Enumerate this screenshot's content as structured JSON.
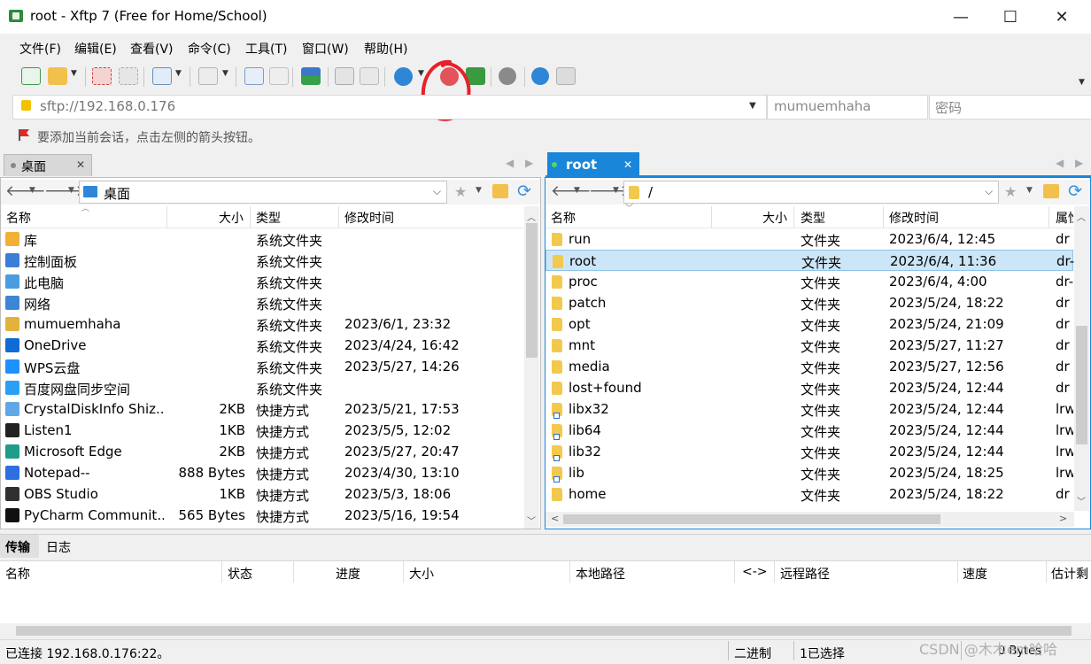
{
  "window": {
    "title": "root - Xftp 7 (Free for Home/School)",
    "controls": {
      "minimize": "—",
      "maximize": "☐",
      "close": "✕"
    }
  },
  "menu": [
    "文件(F)",
    "编辑(E)",
    "查看(V)",
    "命令(C)",
    "工具(T)",
    "窗口(W)",
    "帮助(H)"
  ],
  "address": {
    "url": "sftp://192.168.0.176",
    "username": "mumuemhaha",
    "password_placeholder": "密码"
  },
  "hint": "要添加当前会话，点击左侧的箭头按钮。",
  "left_panel": {
    "tab": "桌面",
    "path": "桌面",
    "columns": [
      "名称",
      "大小",
      "类型",
      "修改时间"
    ],
    "rows": [
      {
        "name": "库",
        "size": "",
        "type": "系统文件夹",
        "modified": "",
        "icon": "library-icon",
        "color": "#f2b134"
      },
      {
        "name": "控制面板",
        "size": "",
        "type": "系统文件夹",
        "modified": "",
        "icon": "control-panel-icon",
        "color": "#3a7fd5"
      },
      {
        "name": "此电脑",
        "size": "",
        "type": "系统文件夹",
        "modified": "",
        "icon": "computer-icon",
        "color": "#4a9de0"
      },
      {
        "name": "网络",
        "size": "",
        "type": "系统文件夹",
        "modified": "",
        "icon": "network-icon",
        "color": "#3d86d6"
      },
      {
        "name": "mumuemhaha",
        "size": "",
        "type": "系统文件夹",
        "modified": "2023/6/1, 23:32",
        "icon": "user-folder-icon",
        "color": "#e3b23c"
      },
      {
        "name": "OneDrive",
        "size": "",
        "type": "系统文件夹",
        "modified": "2023/4/24, 16:42",
        "icon": "onedrive-icon",
        "color": "#0f6cd5"
      },
      {
        "name": "WPS云盘",
        "size": "",
        "type": "系统文件夹",
        "modified": "2023/5/27, 14:26",
        "icon": "wps-cloud-icon",
        "color": "#1e90ff"
      },
      {
        "name": "百度网盘同步空间",
        "size": "",
        "type": "系统文件夹",
        "modified": "",
        "icon": "baidu-netdisk-icon",
        "color": "#2aa0f5"
      },
      {
        "name": "CrystalDiskInfo Shiz...",
        "size": "2KB",
        "type": "快捷方式",
        "modified": "2023/5/21, 17:53",
        "icon": "crystaldiskinfo-icon",
        "color": "#5fa8e8"
      },
      {
        "name": "Listen1",
        "size": "1KB",
        "type": "快捷方式",
        "modified": "2023/5/5, 12:02",
        "icon": "listen1-icon",
        "color": "#222222"
      },
      {
        "name": "Microsoft Edge",
        "size": "2KB",
        "type": "快捷方式",
        "modified": "2023/5/27, 20:47",
        "icon": "edge-icon",
        "color": "#1f9c8a"
      },
      {
        "name": "Notepad--",
        "size": "888 Bytes",
        "type": "快捷方式",
        "modified": "2023/4/30, 13:10",
        "icon": "notepad-icon",
        "color": "#2d6ee0"
      },
      {
        "name": "OBS Studio",
        "size": "1KB",
        "type": "快捷方式",
        "modified": "2023/5/3, 18:06",
        "icon": "obs-icon",
        "color": "#303030"
      },
      {
        "name": "PyCharm Communit...",
        "size": "565 Bytes",
        "type": "快捷方式",
        "modified": "2023/5/16, 19:54",
        "icon": "pycharm-icon",
        "color": "#111111"
      }
    ]
  },
  "right_panel": {
    "tab": "root",
    "path": "/",
    "columns": [
      "名称",
      "大小",
      "类型",
      "修改时间",
      "属性"
    ],
    "rows": [
      {
        "name": "run",
        "type": "文件夹",
        "modified": "2023/6/4, 12:45",
        "attr": "dr",
        "link": false
      },
      {
        "name": "root",
        "type": "文件夹",
        "modified": "2023/6/4, 11:36",
        "attr": "dr-",
        "link": false,
        "selected": true
      },
      {
        "name": "proc",
        "type": "文件夹",
        "modified": "2023/6/4, 4:00",
        "attr": "dr-",
        "link": false
      },
      {
        "name": "patch",
        "type": "文件夹",
        "modified": "2023/5/24, 18:22",
        "attr": "dr",
        "link": false
      },
      {
        "name": "opt",
        "type": "文件夹",
        "modified": "2023/5/24, 21:09",
        "attr": "dr",
        "link": false
      },
      {
        "name": "mnt",
        "type": "文件夹",
        "modified": "2023/5/27, 11:27",
        "attr": "dr",
        "link": false
      },
      {
        "name": "media",
        "type": "文件夹",
        "modified": "2023/5/27, 12:56",
        "attr": "dr",
        "link": false
      },
      {
        "name": "lost+found",
        "type": "文件夹",
        "modified": "2023/5/24, 12:44",
        "attr": "dr",
        "link": false
      },
      {
        "name": "libx32",
        "type": "文件夹",
        "modified": "2023/5/24, 12:44",
        "attr": "lrw",
        "link": true
      },
      {
        "name": "lib64",
        "type": "文件夹",
        "modified": "2023/5/24, 12:44",
        "attr": "lrw",
        "link": true
      },
      {
        "name": "lib32",
        "type": "文件夹",
        "modified": "2023/5/24, 12:44",
        "attr": "lrw",
        "link": true
      },
      {
        "name": "lib",
        "type": "文件夹",
        "modified": "2023/5/24, 18:25",
        "attr": "lrw",
        "link": true
      },
      {
        "name": "home",
        "type": "文件夹",
        "modified": "2023/5/24, 18:22",
        "attr": "dr",
        "link": false
      }
    ]
  },
  "bottom": {
    "tabs": [
      "传输",
      "日志"
    ],
    "columns": [
      "名称",
      "状态",
      "进度",
      "大小",
      "本地路径",
      "<->",
      "远程路径",
      "速度",
      "估计剩"
    ]
  },
  "status": {
    "connection": "已连接 192.168.0.176:22。",
    "mode": "二进制",
    "selection": "1已选择",
    "size": "0 Bytes"
  },
  "watermark": "CSDN @木木em哈哈",
  "colors": {
    "accent": "#1a86d9",
    "selected_row": "#cde6f7",
    "folder": "#f2c94c",
    "annotation": "#e8202a"
  }
}
